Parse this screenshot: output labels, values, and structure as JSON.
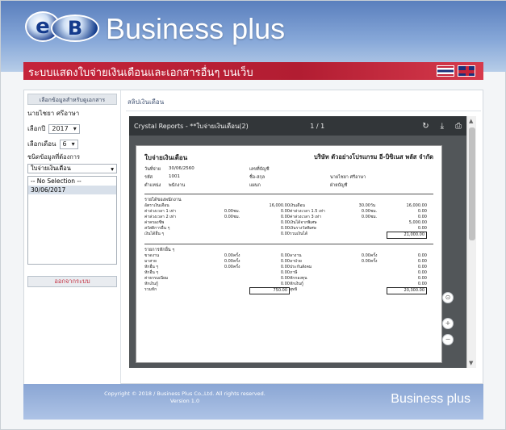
{
  "header": {
    "logo_e": "e",
    "logo_b": "B",
    "brand": "Business plus",
    "subtitle": "ระบบแสดงใบจ่ายเงินเดือนและเอกสารอื่นๆ บนเว็บ",
    "flags": [
      "thai-flag-icon",
      "uk-flag-icon"
    ]
  },
  "sidebar": {
    "heading": "เลือกข้อมูลสำหรับดูเอกสาร",
    "user": "นายไชยา ศรีอาษา",
    "year_label": "เลือกปี",
    "year_value": "2017",
    "month_label": "เลือกเดือน",
    "month_value": "6",
    "doctype_label": "ชนิดข้อมูลที่ต้องการ",
    "doctype_value": "ใบจ่ายเงินเดือน",
    "list_items": [
      "-- No Selection --",
      "30/06/2017"
    ],
    "logout_label": "ออกจากระบบ"
  },
  "content": {
    "breadcrumb": "สลิปเงินเดือน",
    "viewer_title": "Crystal Reports - **ใบจ่ายเงินเดือน(2)",
    "viewer_page": "1 / 1",
    "viewer_icons": [
      "refresh-icon",
      "download-icon",
      "print-icon"
    ]
  },
  "slip": {
    "title": "ใบจ่ายเงินเดือน",
    "company": "บริษัท ตัวอย่างโปรแกรม อี-บิซิเนส พลัส จำกัด",
    "fields": [
      {
        "label": "วันที่จ่าย",
        "value": "30/06/2560",
        "label2": "เลขที่บัญชี",
        "value2": ""
      },
      {
        "label": "รหัส",
        "value": "1001",
        "label2": "ชื่อ-สกุล",
        "value2": "นายไชยา ศรีอาษา"
      },
      {
        "label": "ตำแหน่ง",
        "value": "พนักงาน",
        "label2": "แผนก",
        "value2": "ฝ่ายบัญชี"
      }
    ],
    "income_head": "รายได้ของพนักงาน",
    "income_rows": [
      [
        "อัตราเงินเดือน",
        "",
        "",
        "16,000.00",
        "เงินเดือน",
        "30.00",
        "วัน",
        "16,000.00"
      ],
      [
        "ค่าล่วงเวลา 1 เท่า",
        "0.00",
        "ชม.",
        "0.00",
        "ค่าล่วงเวลา 1.5 เท่า",
        "0.00",
        "ชม.",
        "0.00"
      ],
      [
        "ค่าล่วงเวลา 2 เท่า",
        "0.00",
        "ชม.",
        "0.00",
        "ค่าล่วงเวลา 3 เท่า",
        "0.00",
        "ชม.",
        "0.00"
      ],
      [
        "ค่าครองชีพ",
        "",
        "",
        "0.00",
        "เงินได้จากพิเศษ",
        "",
        "",
        "5,000.00"
      ],
      [
        "สวัสดิการอื่น ๆ",
        "",
        "",
        "0.00",
        "เงินรางวัลพิเศษ",
        "",
        "",
        "0.00"
      ],
      [
        "เงินได้อื่น ๆ",
        "",
        "",
        "0.00",
        "รวมเงินได้",
        "",
        "",
        "21,000.00"
      ]
    ],
    "deduct_head": "รายการหักอื่น ๆ",
    "deduct_rows": [
      [
        "ขาดงาน",
        "0.00",
        "ครั้ง",
        "0.00",
        "ลางาน",
        "0.00",
        "ครั้ง",
        "0.00"
      ],
      [
        "มาสาย",
        "0.00",
        "ครั้ง",
        "0.00",
        "ลาป่วย",
        "0.00",
        "ครั้ง",
        "0.00"
      ],
      [
        "หักอื่น ๆ",
        "0.00",
        "ครั้ง",
        "0.00",
        "ประกันสังคม",
        "",
        "",
        "0.00"
      ],
      [
        "หักอื่น ๆ",
        "",
        "",
        "0.00",
        "ภาษี",
        "",
        "",
        "0.00"
      ],
      [
        "ค่าธรรมเนียม",
        "",
        "",
        "0.00",
        "หักกองทุน",
        "",
        "",
        "0.00"
      ],
      [
        "หักเงินกู้",
        "",
        "",
        "0.00",
        "หักเงินกู้",
        "",
        "",
        "0.00"
      ],
      [
        "รวมหัก",
        "",
        "",
        "750.00",
        "สุทธิ",
        "",
        "",
        "20,300.00"
      ]
    ]
  },
  "footer": {
    "copyright": "Copyright © 2018 / Business Plus Co.,Ltd. All rights reserved.",
    "version": "Version 1.0",
    "brand": "Business plus"
  },
  "colors": {
    "red": "#c5243a",
    "blue": "#5a7fbd",
    "navy": "#1b2f7a"
  }
}
